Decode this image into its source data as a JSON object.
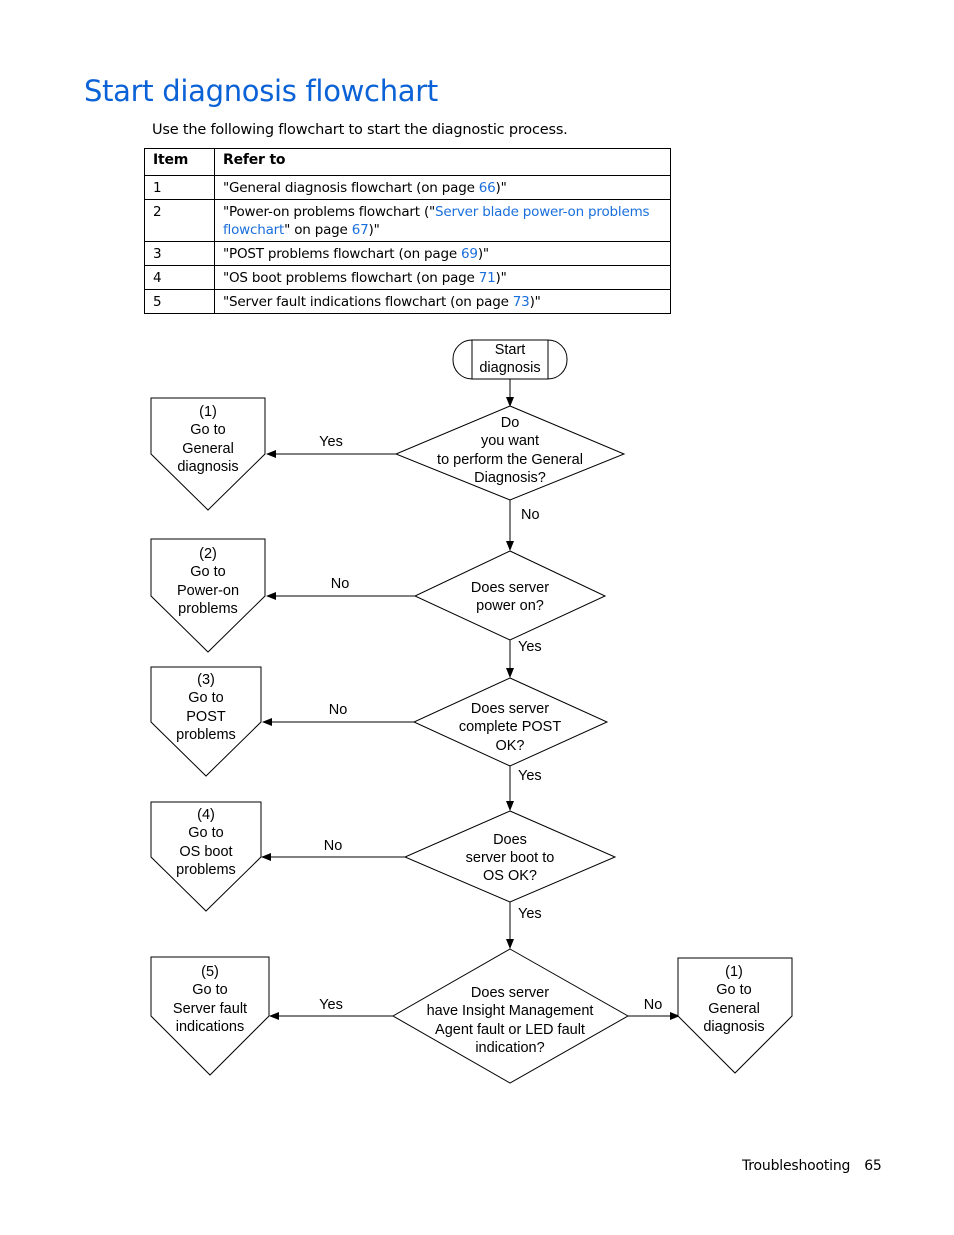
{
  "page": {
    "title": "Start diagnosis flowchart",
    "intro": "Use the following flowchart to start the diagnostic process."
  },
  "table": {
    "headers": [
      "Item",
      "Refer to"
    ],
    "rows": [
      {
        "item": "1",
        "pre": "\"General diagnosis flowchart (on page ",
        "link": "66",
        "post": ")\""
      },
      {
        "item": "2",
        "pre": "\"Power-on problems flowchart (\"",
        "link": "Server blade power-on problems flowchart",
        "mid": "\" on page ",
        "link2": "67",
        "post": ")\""
      },
      {
        "item": "3",
        "pre": "\"POST problems flowchart (on page ",
        "link": "69",
        "post": ")\""
      },
      {
        "item": "4",
        "pre": "\"OS boot problems flowchart (on page ",
        "link": "71",
        "post": ")\""
      },
      {
        "item": "5",
        "pre": "\"Server fault indications flowchart (on page ",
        "link": "73",
        "post": ")\""
      }
    ]
  },
  "flowchart": {
    "start": [
      "Start",
      "diagnosis"
    ],
    "decisions": [
      {
        "lines": [
          "Do",
          "you want",
          "to perform the General",
          "Diagnosis?"
        ],
        "left_label": "Yes",
        "down_label": "No"
      },
      {
        "lines": [
          "Does server",
          "power on?"
        ],
        "left_label": "No",
        "down_label": "Yes"
      },
      {
        "lines": [
          "Does server",
          "complete POST",
          "OK?"
        ],
        "left_label": "No",
        "down_label": "Yes"
      },
      {
        "lines": [
          "Does",
          "server boot to",
          "OS OK?"
        ],
        "left_label": "No",
        "down_label": "Yes"
      },
      {
        "lines": [
          "Does server",
          "have Insight Management",
          "Agent fault or LED fault",
          "indication?"
        ],
        "left_label": "Yes",
        "right_label": "No"
      }
    ],
    "connectors": [
      {
        "lines": [
          "(1)",
          "Go to",
          "General",
          "diagnosis"
        ]
      },
      {
        "lines": [
          "(2)",
          "Go to",
          "Power-on",
          "problems"
        ]
      },
      {
        "lines": [
          "(3)",
          "Go to",
          "POST",
          "problems"
        ]
      },
      {
        "lines": [
          "(4)",
          "Go to",
          "OS boot",
          "problems"
        ]
      },
      {
        "lines": [
          "(5)",
          "Go to",
          "Server fault",
          "indications"
        ]
      },
      {
        "lines": [
          "(1)",
          "Go to",
          "General",
          "diagnosis"
        ]
      }
    ]
  },
  "footer": {
    "section": "Troubleshooting",
    "page_number": "65"
  }
}
